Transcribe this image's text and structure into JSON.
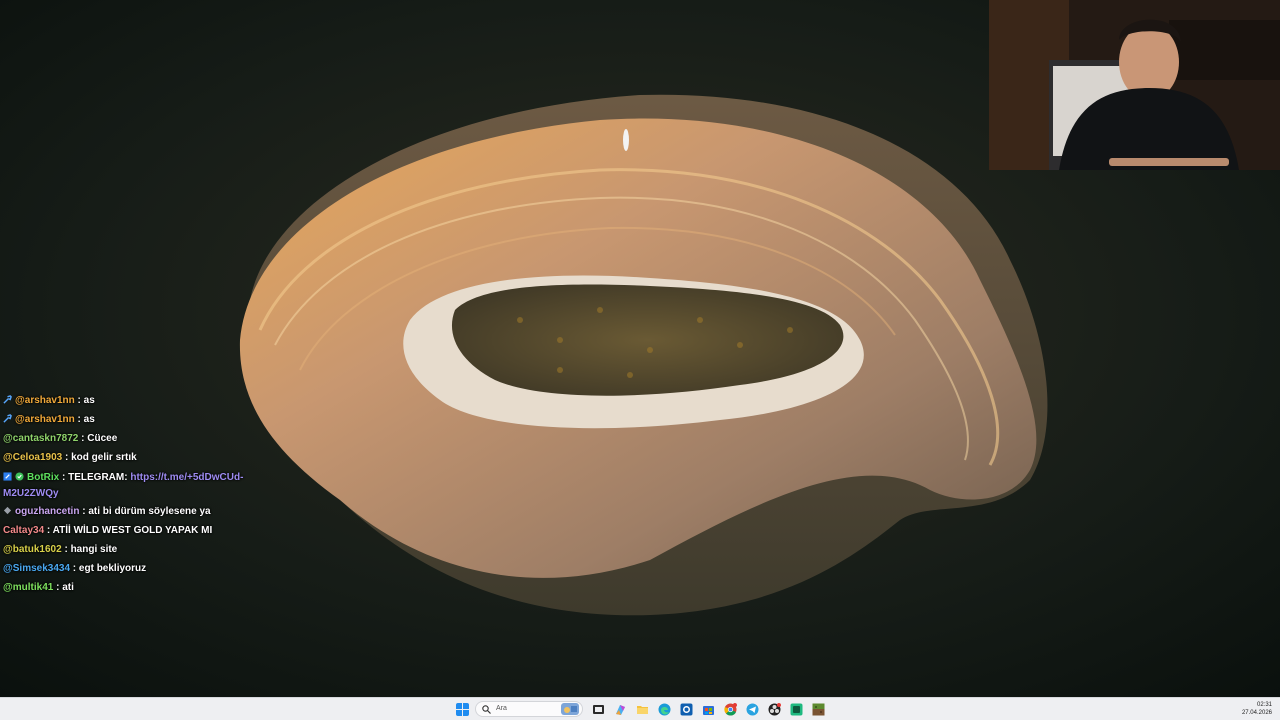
{
  "chat": {
    "messages": [
      {
        "user": "@arshav1nn",
        "sep": " : ",
        "text": "as",
        "badge": "wrench",
        "color": "#f0a93a"
      },
      {
        "user": "@arshav1nn",
        "sep": " : ",
        "text": "as",
        "badge": "wrench",
        "color": "#f0a93a"
      },
      {
        "user": "@cantaskn7872",
        "sep": " : ",
        "text": "Cücee",
        "color": "#8fd36b"
      },
      {
        "user": "@Celoa1903",
        "sep": " : ",
        "text": "kod gelir srtık",
        "color": "#e7c14a"
      },
      {
        "user": "BotRix",
        "sep": " : ",
        "text": "TELEGRAM: ",
        "link": "https://t.me/+5dDwCUd-M2U2ZWQy",
        "badge": "bot",
        "color": "#5ee05e"
      },
      {
        "user": "oguzhancetin",
        "sep": " : ",
        "text": "ati bi dürüm söylesene ya",
        "badge": "sub",
        "color": "#c9a6f0"
      },
      {
        "user": "Caltay34",
        "sep": " : ",
        "text": "ATİİ WİLD WEST GOLD YAPAK MI",
        "color": "#f28a8a"
      },
      {
        "user": "@batuk1602",
        "sep": " : ",
        "text": "hangi site",
        "color": "#d8d14a"
      },
      {
        "user": "@Simsek3434",
        "sep": " : ",
        "text": "egt bekliyoruz",
        "color": "#4aa8f0"
      },
      {
        "user": "@multik41",
        "sep": " : ",
        "text": "ati",
        "color": "#7ee05e"
      }
    ]
  },
  "taskbar": {
    "search_placeholder": "Ara",
    "clock_time": "02:31",
    "clock_date": "27.04.2026",
    "icons": [
      "windows-start-icon",
      "search-icon",
      "search-highlight-icon",
      "task-view-icon",
      "copilot-icon",
      "file-explorer-icon",
      "edge-icon",
      "edge-browser-icon",
      "store-icon",
      "mail-icon",
      "chrome-icon",
      "telegram-icon",
      "obs-icon",
      "app-icon",
      "minecraft-icon"
    ]
  }
}
